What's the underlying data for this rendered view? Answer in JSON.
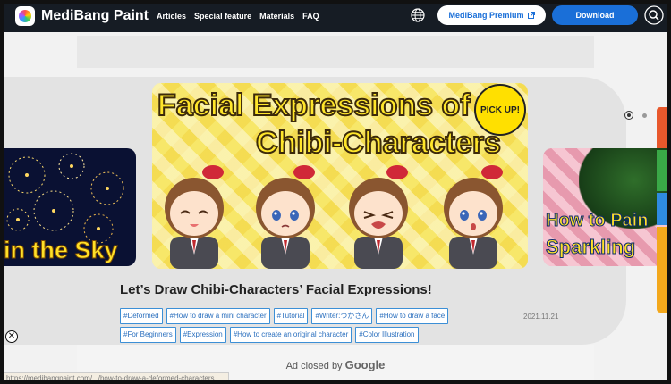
{
  "header": {
    "brand": "MediBang Paint",
    "nav": [
      "Articles",
      "Special feature",
      "Materials",
      "FAQ"
    ],
    "premium_label": "MediBang Premium",
    "download_label": "Download"
  },
  "carousel": {
    "left_slide_text": "in the Sky",
    "main_title_line1": "Facial Expressions of",
    "main_title_line2": "Chibi-Characters",
    "badge": "PICK UP!",
    "right_slide_line1": "How to Pain",
    "right_slide_line2": "Sparkling"
  },
  "article": {
    "title": "Let’s Draw Chibi-Characters’ Facial Expressions!",
    "date": "2021.11.21",
    "tags": [
      "#Deformed",
      "#How to draw a mini character",
      "#Tutorial",
      "#Writer:つかさん",
      "#How to draw a face",
      "#For Beginners",
      "#Expression",
      "#How to create an original character",
      "#Color Illustration"
    ]
  },
  "ad": {
    "closed_text": "Ad closed by",
    "google": "Google"
  },
  "status_bar": {
    "url": "https://medibangpaint.com/.../how-to-draw-a-deformed-characters..."
  },
  "colors": {
    "header_bg": "#161c24",
    "accent": "#1a6fd8",
    "tag_border": "#3c8fd6"
  }
}
